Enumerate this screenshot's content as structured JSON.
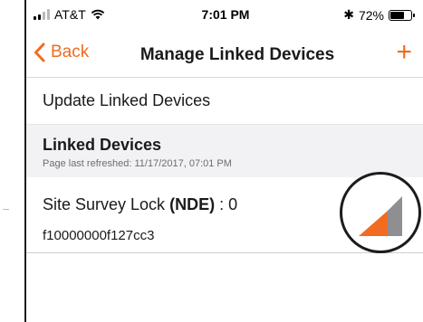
{
  "statusbar": {
    "carrier": "AT&T",
    "time": "7:01 PM",
    "battery_text": "72%",
    "battery_level": 0.72
  },
  "navbar": {
    "back_label": "Back",
    "title": "Manage Linked Devices",
    "add_symbol": "+"
  },
  "menu": {
    "update_label": "Update Linked Devices"
  },
  "section": {
    "title": "Linked Devices",
    "subtitle": "Page last refreshed: 11/17/2017, 07:01 PM"
  },
  "device": {
    "name": "Site Survey Lock",
    "type": "(NDE)",
    "count_separator": ":",
    "count": "0",
    "id": "f10000000f127cc3"
  },
  "colors": {
    "accent": "#f26b21",
    "signal_bar_inactive": "#8e8e93"
  },
  "icons": {
    "left_edge": "arrow-right-icon",
    "signal": "signal-strength-icon"
  }
}
